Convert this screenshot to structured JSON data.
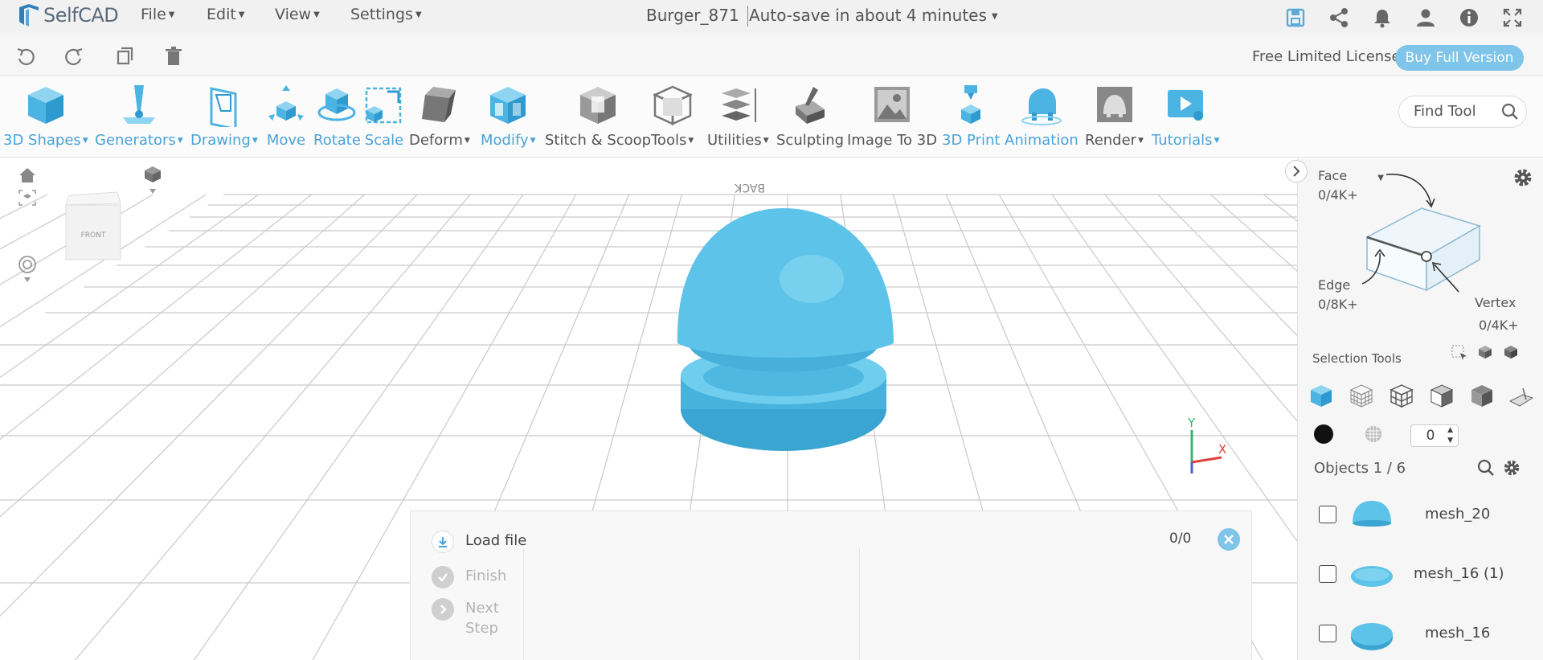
{
  "app": {
    "name": "SelfCAD",
    "document_title": "Burger_871",
    "autosave_text": "Auto-save in about 4 minutes"
  },
  "menu": {
    "items": [
      {
        "label": "File"
      },
      {
        "label": "Edit"
      },
      {
        "label": "View"
      },
      {
        "label": "Settings"
      }
    ]
  },
  "top_icons": [
    "save-icon",
    "share-icon",
    "bell-icon",
    "user-icon",
    "info-icon",
    "fullscreen-icon"
  ],
  "edit_bar": {
    "icons": [
      "undo-icon",
      "redo-icon",
      "copy-icon",
      "delete-icon"
    ],
    "license_text": "Free Limited License",
    "buy_button": "Buy Full Version"
  },
  "toolbar": {
    "tools": [
      {
        "label": "3D Shapes",
        "dropdown": true,
        "accent": true
      },
      {
        "label": "Generators",
        "dropdown": true,
        "accent": true
      },
      {
        "label": "Drawing",
        "dropdown": true,
        "accent": true
      },
      {
        "label": "Move",
        "dropdown": false,
        "accent": true
      },
      {
        "label": "Rotate",
        "dropdown": false,
        "accent": true
      },
      {
        "label": "Scale",
        "dropdown": false,
        "accent": true
      },
      {
        "label": "Deform",
        "dropdown": true,
        "accent": false
      },
      {
        "label": "Modify",
        "dropdown": true,
        "accent": true
      },
      {
        "label": "Stitch & Scoop",
        "dropdown": false,
        "accent": false
      },
      {
        "label": "Tools",
        "dropdown": true,
        "accent": false
      },
      {
        "label": "Utilities",
        "dropdown": true,
        "accent": false
      },
      {
        "label": "Sculpting",
        "dropdown": false,
        "accent": false
      },
      {
        "label": "Image To 3D",
        "dropdown": false,
        "accent": false
      },
      {
        "label": "3D Print",
        "dropdown": false,
        "accent": true
      },
      {
        "label": "Animation",
        "dropdown": false,
        "accent": true
      },
      {
        "label": "Render",
        "dropdown": true,
        "accent": false
      },
      {
        "label": "Tutorials",
        "dropdown": true,
        "accent": true
      }
    ],
    "find_tool_placeholder": "Find Tool"
  },
  "viewport": {
    "view_cube_face": "FRONT",
    "grid_label": "BACK",
    "axes": {
      "y": "Y",
      "x": "X"
    }
  },
  "steps_panel": {
    "steps": [
      {
        "label": "Load file",
        "active": true
      },
      {
        "label": "Finish",
        "active": false
      },
      {
        "label": "Next Step",
        "active": false
      }
    ],
    "counter": "0/0"
  },
  "selection": {
    "face_label": "Face",
    "face_count": "0/4K+",
    "edge_label": "Edge",
    "edge_count": "0/8K+",
    "vertex_label": "Vertex",
    "vertex_count": "0/4K+",
    "tools_label": "Selection Tools",
    "numeric_value": "0"
  },
  "objects": {
    "header": "Objects 1 / 6",
    "items": [
      {
        "name": "mesh_20"
      },
      {
        "name": "mesh_16 (1)"
      },
      {
        "name": "mesh_16"
      }
    ]
  },
  "colors": {
    "accent": "#4aa3d8",
    "model": "#5cc3e6",
    "button": "#7fc4e9"
  }
}
